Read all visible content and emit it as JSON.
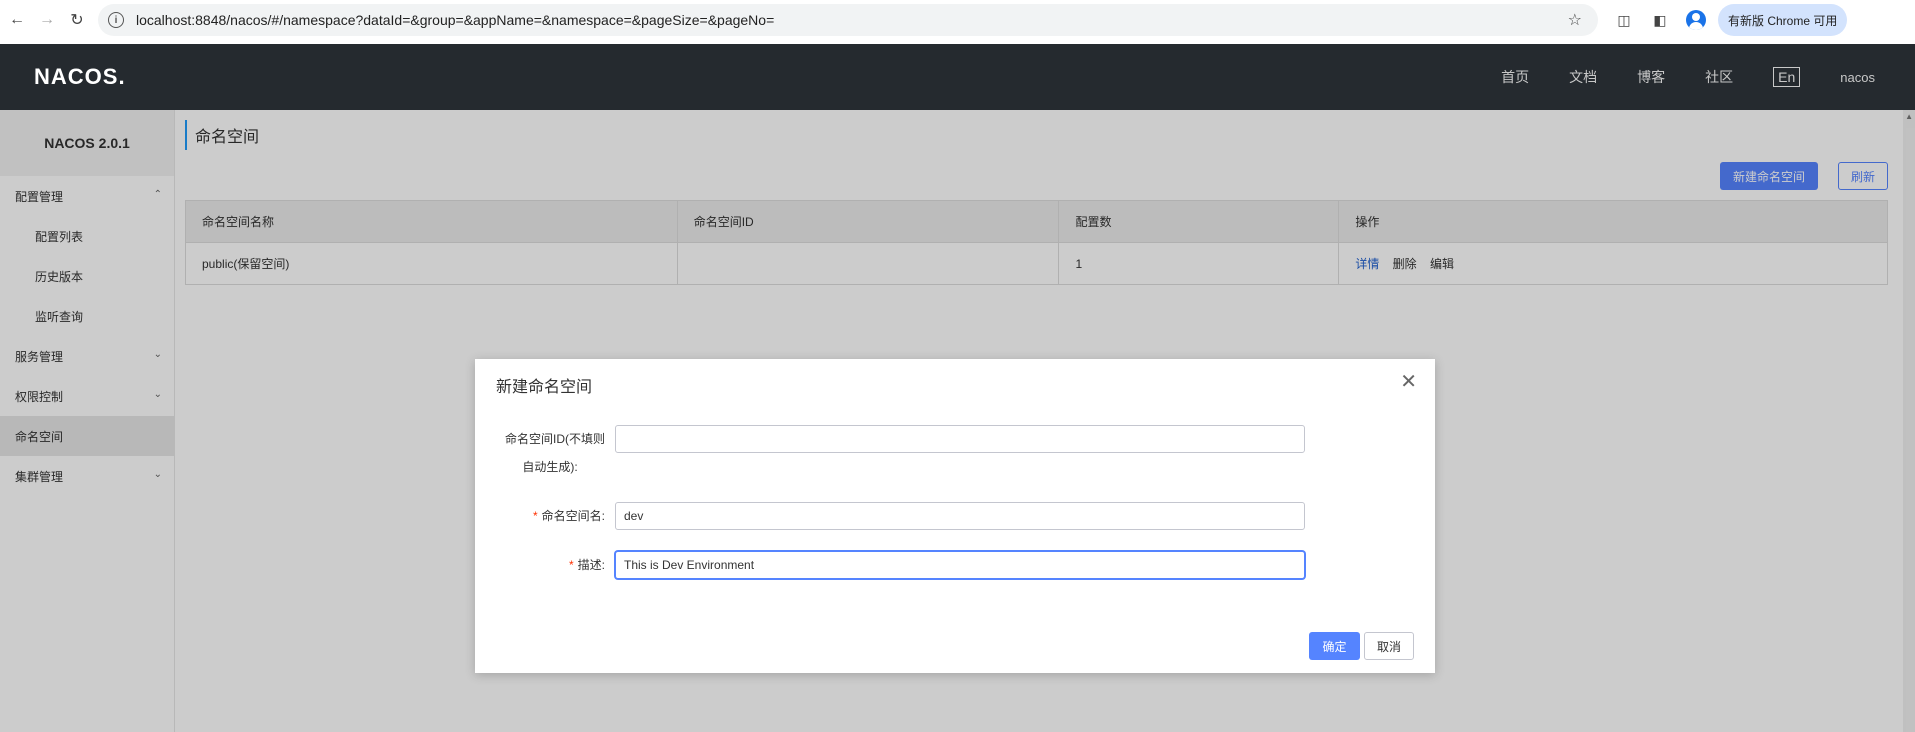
{
  "browser": {
    "url": "localhost:8848/nacos/#/namespace?dataId=&group=&appName=&namespace=&pageSize=&pageNo=",
    "update_chip": "有新版 Chrome 可用"
  },
  "header": {
    "logo": "NACOS.",
    "nav": [
      "首页",
      "文档",
      "博客",
      "社区"
    ],
    "lang": "En",
    "user": "nacos"
  },
  "sidebar": {
    "title": "NACOS 2.0.1",
    "items": [
      {
        "label": "配置管理",
        "type": "group",
        "chevron": "up"
      },
      {
        "label": "配置列表",
        "type": "sub"
      },
      {
        "label": "历史版本",
        "type": "sub"
      },
      {
        "label": "监听查询",
        "type": "sub"
      },
      {
        "label": "服务管理",
        "type": "group",
        "chevron": "down"
      },
      {
        "label": "权限控制",
        "type": "group",
        "chevron": "down"
      },
      {
        "label": "命名空间",
        "type": "item",
        "active": true
      },
      {
        "label": "集群管理",
        "type": "group",
        "chevron": "down"
      }
    ]
  },
  "main": {
    "title": "命名空间",
    "new_button": "新建命名空间",
    "refresh_button": "刷新",
    "table": {
      "headers": [
        "命名空间名称",
        "命名空间ID",
        "配置数",
        "操作"
      ],
      "rows": [
        {
          "name": "public(保留空间)",
          "id": "",
          "count": "1",
          "ops": [
            "详情",
            "删除",
            "编辑"
          ]
        }
      ]
    }
  },
  "dialog": {
    "title": "新建命名空间",
    "fields": {
      "id_label_line1": "命名空间ID(不填则",
      "id_label_line2": "自动生成):",
      "id_value": "",
      "name_label": "命名空间名:",
      "name_value": "dev",
      "desc_label": "描述:",
      "desc_value": "This is Dev Environment"
    },
    "ok_button": "确定",
    "cancel_button": "取消"
  },
  "colors": {
    "header_bg": "#252a2f",
    "primary": "#5584ff",
    "required": "#ff3000",
    "link": "#1f5fcf"
  }
}
